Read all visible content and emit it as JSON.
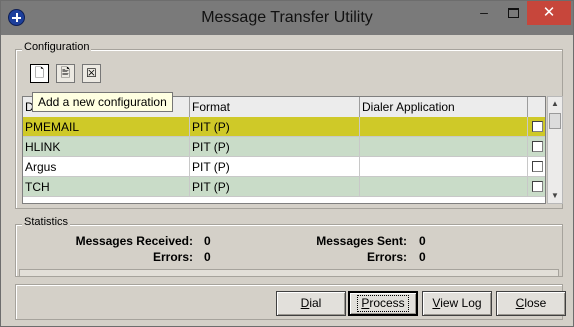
{
  "window": {
    "title": "Message Transfer Utility",
    "controls": {
      "minimize": "–",
      "maximize": "",
      "close": "✕"
    }
  },
  "configuration": {
    "group_label": "Configuration",
    "toolbar": [
      {
        "name": "new-config-button",
        "icon": "new-document-icon",
        "glyph": "🗋"
      },
      {
        "name": "edit-config-button",
        "icon": "edit-document-icon",
        "glyph": "🖹"
      },
      {
        "name": "delete-config-button",
        "icon": "delete-icon",
        "glyph": "☒"
      }
    ],
    "tooltip": "Add a new configuration",
    "columns": [
      "D",
      "Format",
      "Dialer Application",
      ""
    ],
    "rows": [
      {
        "name": "PMEMAIL",
        "format": "PIT (P)",
        "dialer": "",
        "checked": false,
        "color": "#cfc928",
        "selected": true
      },
      {
        "name": "HLINK",
        "format": "PIT (P)",
        "dialer": "",
        "checked": false,
        "color": "#c9dcc8"
      },
      {
        "name": "Argus",
        "format": "PIT (P)",
        "dialer": "",
        "checked": false,
        "color": "#ffffff"
      },
      {
        "name": "TCH",
        "format": "PIT (P)",
        "dialer": "",
        "checked": false,
        "color": "#c9dcc8"
      }
    ]
  },
  "statistics": {
    "group_label": "Statistics",
    "messages_received_label": "Messages Received:",
    "messages_received": "0",
    "errors_left_label": "Errors:",
    "errors_left": "0",
    "messages_sent_label": "Messages Sent:",
    "messages_sent": "0",
    "errors_right_label": "Errors:",
    "errors_right": "0"
  },
  "buttons": {
    "dial": {
      "pre": "",
      "u": "D",
      "post": "ial"
    },
    "process": {
      "pre": "",
      "u": "P",
      "post": "rocess"
    },
    "view_log": {
      "pre": "",
      "u": "V",
      "post": "iew Log"
    },
    "close": {
      "pre": "",
      "u": "C",
      "post": "lose"
    }
  }
}
